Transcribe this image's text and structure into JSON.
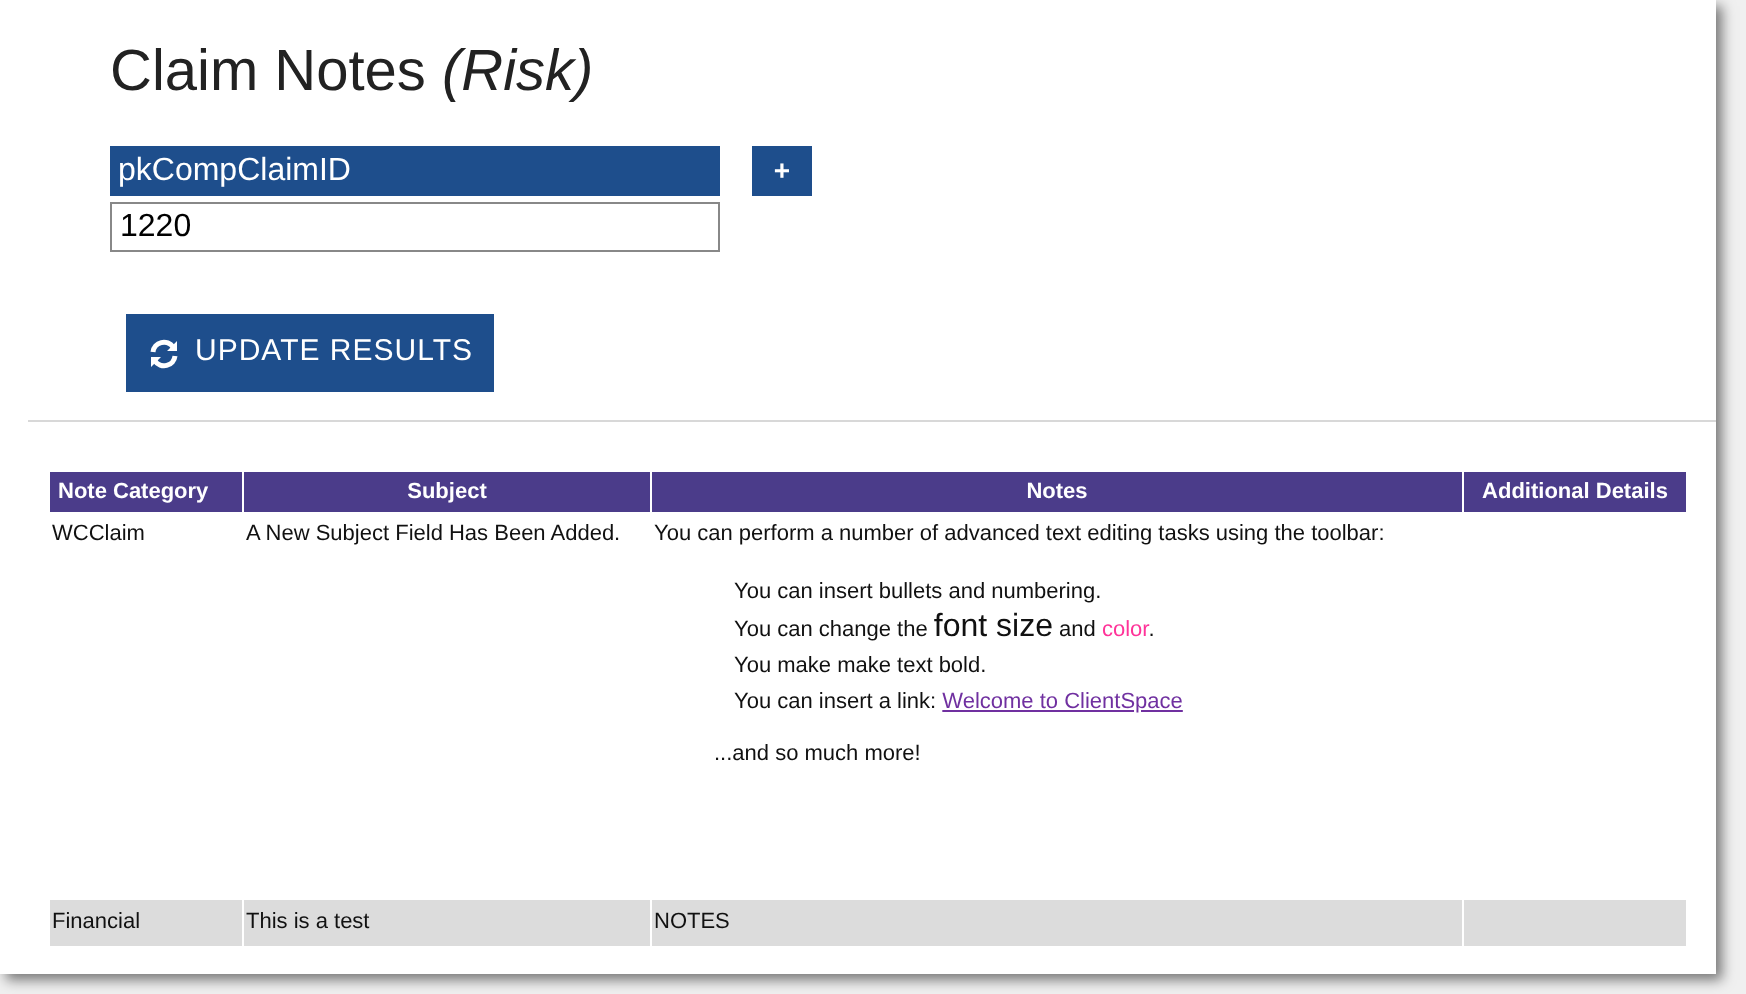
{
  "title": {
    "main": "Claim Notes",
    "qualifier": "(Risk)"
  },
  "filter": {
    "label": "pkCompClaimID",
    "add_button": "+",
    "value": "1220"
  },
  "update_button": {
    "label": "UPDATE RESULTS"
  },
  "table": {
    "columns": [
      "Note Category",
      "Subject",
      "Notes",
      "Additional Details"
    ],
    "rows": [
      {
        "category": "WCClaim",
        "subject": "A New Subject Field Has Been Added.",
        "notes": {
          "kind": "rich",
          "intro": "You can perform a number of advanced text editing tasks using the toolbar:",
          "lines": [
            [
              {
                "kind": "text",
                "text": "You can insert bullets and numbering."
              }
            ],
            [
              {
                "kind": "text",
                "text": "You can change the "
              },
              {
                "kind": "large",
                "text": "font size"
              },
              {
                "kind": "text",
                "text": " and "
              },
              {
                "kind": "colored",
                "text": "color",
                "color": "#ff3399"
              },
              {
                "kind": "text",
                "text": "."
              }
            ],
            [
              {
                "kind": "text",
                "text": "You make make text bold."
              }
            ],
            [
              {
                "kind": "text",
                "text": "You can insert a link: "
              },
              {
                "kind": "link",
                "text": "Welcome to ClientSpace"
              }
            ]
          ],
          "outro": "...and so much more!"
        }
      },
      {
        "category": "Financial",
        "subject": "This is a test",
        "notes": {
          "kind": "plain",
          "text": "NOTES"
        }
      }
    ]
  }
}
